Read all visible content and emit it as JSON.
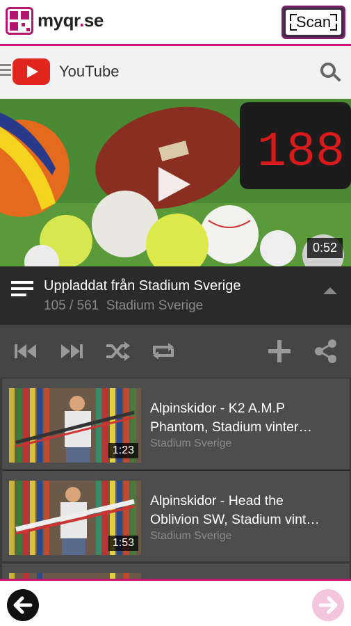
{
  "brand": {
    "name": "myqr",
    "dot": ".",
    "tld": "se"
  },
  "scan_label": "Scan",
  "youtube": {
    "title": "YouTube"
  },
  "video": {
    "duration": "0:52",
    "scoreboard": "188"
  },
  "playlist": {
    "title": "Uppladdat från Stadium Sverige",
    "position": "105 / 561",
    "channel": "Stadium Sverige"
  },
  "items": [
    {
      "title_line1": "Alpinskidor - K2 A.M.P",
      "title_line2": "Phantom, Stadium vinter…",
      "channel": "Stadium Sverige",
      "duration": "1:23"
    },
    {
      "title_line1": "Alpinskidor - Head the",
      "title_line2": "Oblivion SW, Stadium vint…",
      "channel": "Stadium Sverige",
      "duration": "1:53"
    }
  ],
  "colors": {
    "accent": "#c8157a",
    "youtube_red": "#e0261c",
    "dark": "#2a2a2a"
  },
  "icons": [
    "qr-logo-icon",
    "menu-icon",
    "search-icon",
    "play-icon",
    "playlist-icon",
    "chevron-up-icon",
    "skip-previous-icon",
    "skip-next-icon",
    "shuffle-icon",
    "repeat-icon",
    "add-icon",
    "share-icon",
    "back-arrow-icon",
    "forward-arrow-icon"
  ]
}
